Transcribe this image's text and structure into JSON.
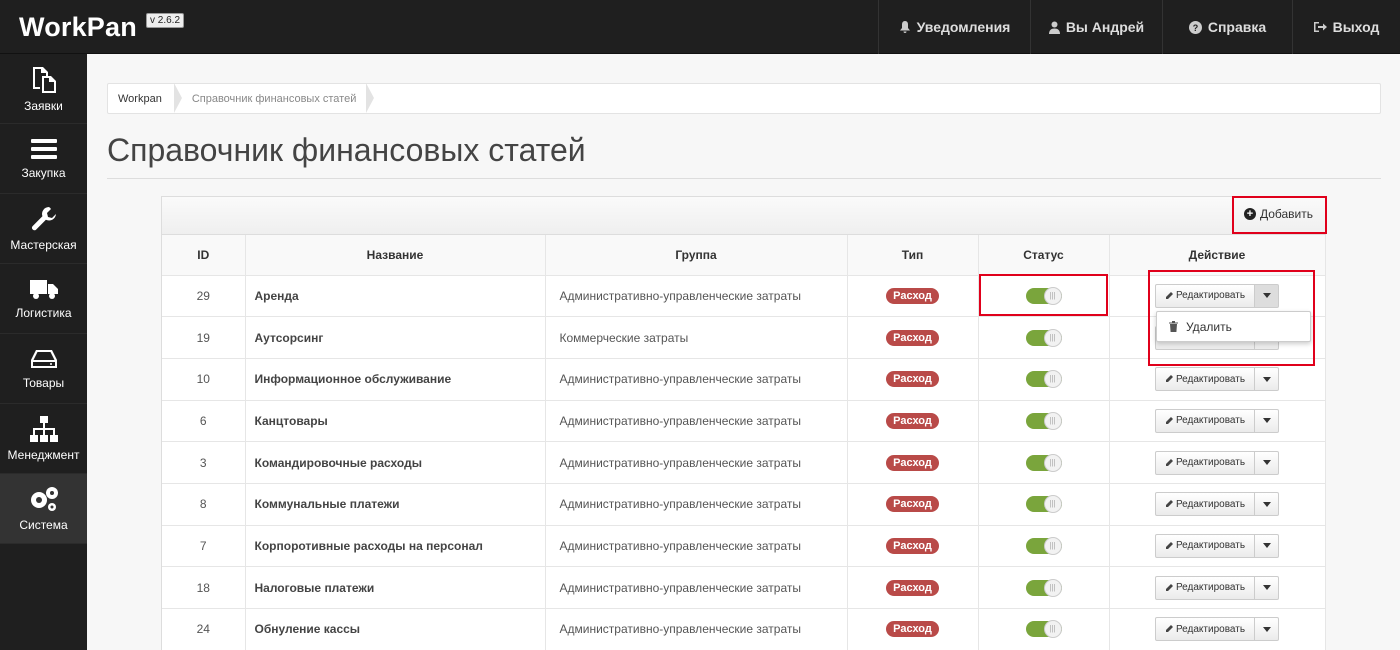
{
  "app": {
    "brand": "WorkPan",
    "version": "v 2.6.2"
  },
  "topnav": [
    {
      "label": "Уведомления",
      "icon": "bell-icon"
    },
    {
      "label": "Вы Андрей",
      "icon": "user-icon"
    },
    {
      "label": "Справка",
      "icon": "question-circle-icon"
    },
    {
      "label": "Выход",
      "icon": "sign-out-icon"
    }
  ],
  "sidebar": [
    {
      "label": "Заявки",
      "icon": "documents-icon"
    },
    {
      "label": "Закупка",
      "icon": "menu-bars-icon"
    },
    {
      "label": "Мастерская",
      "icon": "wrench-icon"
    },
    {
      "label": "Логистика",
      "icon": "truck-icon"
    },
    {
      "label": "Товары",
      "icon": "hdd-icon"
    },
    {
      "label": "Менеджмент",
      "icon": "sitemap-icon"
    },
    {
      "label": "Система",
      "icon": "gears-icon",
      "active": true
    }
  ],
  "breadcrumb": [
    "Workpan",
    "Справочник финансовых статей"
  ],
  "page": {
    "title": "Справочник финансовых статей"
  },
  "panel": {
    "add_label": "Добавить"
  },
  "table": {
    "headers": [
      "ID",
      "Название",
      "Группа",
      "Тип",
      "Статус",
      "Действие"
    ],
    "edit_label": "Редактировать",
    "rows": [
      {
        "id": "29",
        "name": "Аренда",
        "group": "Административно-управленческие затраты",
        "type": "Расход"
      },
      {
        "id": "19",
        "name": "Аутсорсинг",
        "group": "Коммерческие затраты",
        "type": "Расход"
      },
      {
        "id": "10",
        "name": "Информационное обслуживание",
        "group": "Административно-управленческие затраты",
        "type": "Расход"
      },
      {
        "id": "6",
        "name": "Канцтовары",
        "group": "Административно-управленческие затраты",
        "type": "Расход"
      },
      {
        "id": "3",
        "name": "Командировочные расходы",
        "group": "Административно-управленческие затраты",
        "type": "Расход"
      },
      {
        "id": "8",
        "name": "Коммунальные платежи",
        "group": "Административно-управленческие затраты",
        "type": "Расход"
      },
      {
        "id": "7",
        "name": "Корпоротивные расходы на персонал",
        "group": "Административно-управленческие затраты",
        "type": "Расход"
      },
      {
        "id": "18",
        "name": "Налоговые платежи",
        "group": "Административно-управленческие затраты",
        "type": "Расход"
      },
      {
        "id": "24",
        "name": "Обнуление кассы",
        "group": "Административно-управленческие затраты",
        "type": "Расход"
      }
    ]
  },
  "dropdown": {
    "delete_label": "Удалить",
    "icon": "trash-icon"
  },
  "colors": {
    "badge": "#b94a48",
    "toggle_on": "#7aa53c",
    "highlight": "#e0001b"
  }
}
